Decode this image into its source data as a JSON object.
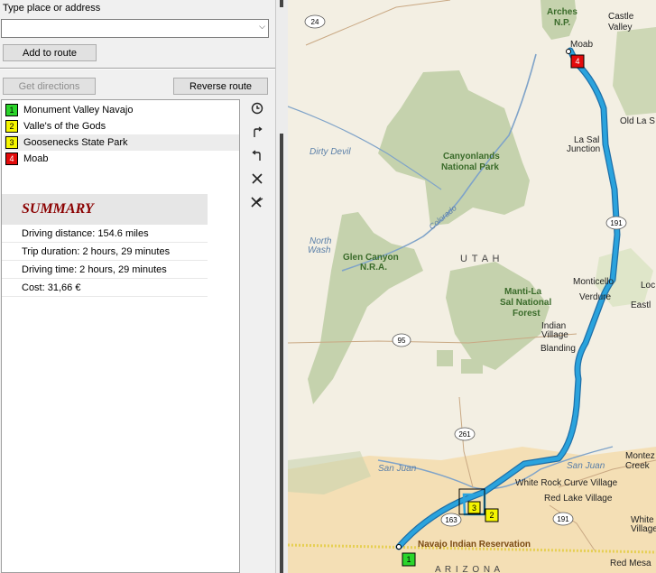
{
  "search": {
    "label": "Type place or address",
    "value": "",
    "placeholder": ""
  },
  "buttons": {
    "add_to_route": "Add to route",
    "get_directions": "Get directions",
    "reverse_route": "Reverse route"
  },
  "route_stops": [
    {
      "number": "1",
      "name": "Monument Valley Navajo",
      "color": "#2bd52b"
    },
    {
      "number": "2",
      "name": "Valle's of the Gods",
      "color": "#f5f500"
    },
    {
      "number": "3",
      "name": "Goosenecks State Park",
      "color": "#f5f500"
    },
    {
      "number": "4",
      "name": "Moab",
      "color": "#e30b0b"
    }
  ],
  "summary": {
    "title": "SUMMARY",
    "rows": [
      "Driving distance:  154.6 miles",
      "Trip duration:  2 hours, 29 minutes",
      "Driving time:  2 hours, 29 minutes",
      "Cost:  31,66 €"
    ]
  },
  "toolbar_icons": [
    "clock-icon",
    "turn-right-icon",
    "turn-left-icon",
    "delete-icon",
    "clear-route-icon"
  ],
  "map": {
    "route_color": "#2aa3dd",
    "park_color": "#c5d2ad",
    "reservation_color": "#f4dfb5",
    "labels": {
      "arches": "Arches",
      "arches2": "N.P.",
      "castle": "Castle",
      "valley": "Valley",
      "moab": "Moab",
      "old_la": "Old La S",
      "la_sal": "La Sal",
      "junction": "Junction",
      "dirty_devil": "Dirty Devil",
      "canyonlands": "Canyonlands",
      "national_park": "National Park",
      "colorado": "Colorado",
      "north": "North",
      "wash": "Wash",
      "glen": "Glen Canyon",
      "nra": "N.R.A.",
      "utah": "U T A H",
      "manti": "Manti-La",
      "sal_national": "Sal National",
      "forest": "Forest",
      "monticello": "Monticello",
      "verdure": "Verdure",
      "loc": "Loc",
      "eastl": "Eastl",
      "indian": "Indian",
      "village": "Village",
      "blanding": "Blanding",
      "montez": "Montez",
      "creek": "Creek",
      "san_juan1": "San Juan",
      "san_juan2": "San Juan",
      "white_rock": "White Rock Curve Village",
      "red_lake": "Red Lake Village",
      "white": "White",
      "village2": "Village",
      "navajo": "Navajo Indian Reservation",
      "arizona": "A R I Z O N A",
      "red_mesa": "Red Mesa",
      "hwy_24": "24",
      "hwy_191a": "191",
      "hwy_191b": "191",
      "hwy_191c": "191",
      "hwy_95": "95",
      "hwy_261": "261",
      "hwy_163": "163",
      "m1": "1",
      "m2": "2",
      "m3": "3",
      "m4": "4"
    }
  }
}
